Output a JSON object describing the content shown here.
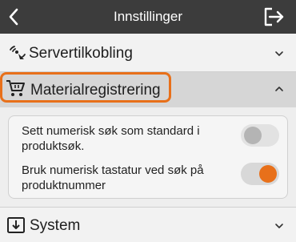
{
  "header": {
    "title": "Innstillinger",
    "back_icon": "chevron-left-icon",
    "logout_icon": "logout-icon"
  },
  "sections": {
    "server": {
      "label": "Servertilkobling",
      "icon": "wireless-connection-icon",
      "state": "collapsed"
    },
    "material": {
      "label": "Materialregistrering",
      "icon": "shopping-cart-icon",
      "state": "expanded"
    },
    "system": {
      "label": "System",
      "icon": "download-box-icon",
      "state": "collapsed"
    }
  },
  "settings": [
    {
      "label": "Sett numerisk søk som standard i produktsøk.",
      "enabled": false
    },
    {
      "label": "Bruk numerisk tastatur ved søk på produktnummer",
      "enabled": true
    }
  ],
  "colors": {
    "accent": "#e8701a",
    "topbar": "#3c3c3c"
  }
}
